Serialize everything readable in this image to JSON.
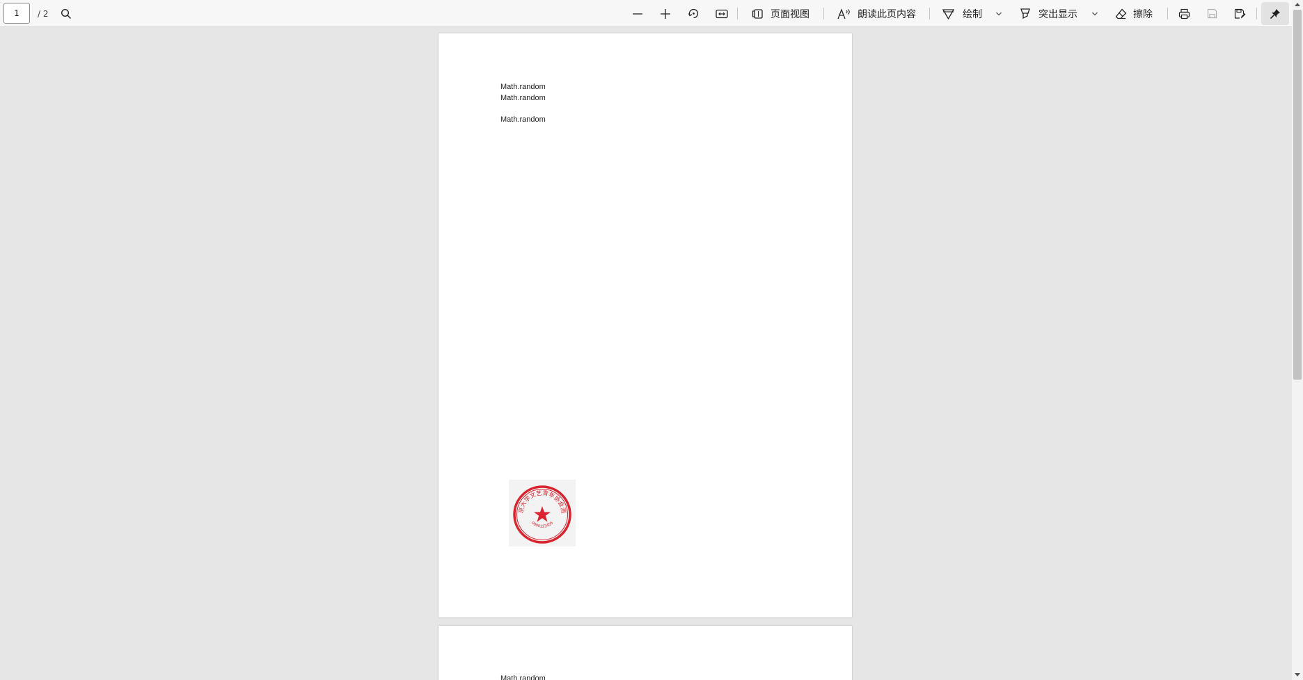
{
  "toolbar": {
    "page_number": "1",
    "page_total": "/ 2",
    "page_view_label": "页面视图",
    "read_aloud_label": "朗读此页内容",
    "draw_label": "绘制",
    "highlight_label": "突出显示",
    "erase_label": "擦除",
    "icons": [
      "search-icon",
      "zoom-out-icon",
      "zoom-in-icon",
      "rotate-icon",
      "fit-width-icon",
      "page-view-icon",
      "read-aloud-icon",
      "draw-icon",
      "chevron-down-icon",
      "highlight-icon",
      "eraser-icon",
      "print-icon",
      "save-icon",
      "save-as-icon",
      "pin-icon"
    ]
  },
  "document": {
    "page1_lines": [
      "Math.random",
      "Math.random",
      "Math.random"
    ],
    "page2_lines": [
      "Math.random"
    ],
    "seal": {
      "text": "北京大学文艺青年协会测试",
      "number": "0000123456",
      "color": "#d9232e"
    }
  },
  "colors": {
    "background": "#e6e6e6",
    "toolbar": "#f7f7f7",
    "page": "#ffffff",
    "seal_red": "#d9232e"
  }
}
